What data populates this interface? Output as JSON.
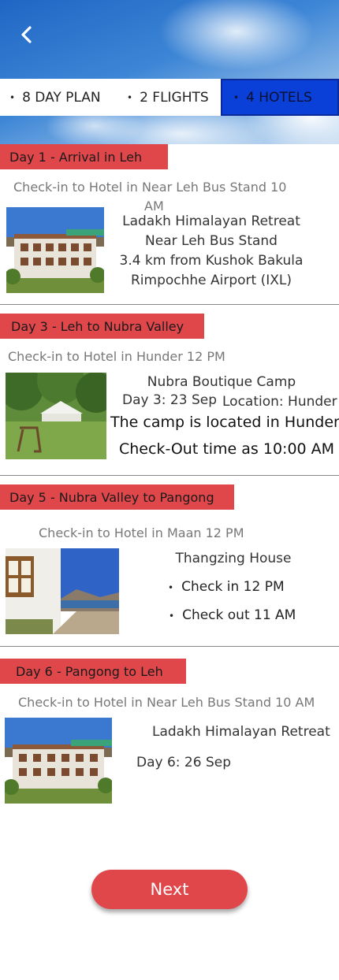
{
  "header": {
    "back_icon": "chevron-left-icon",
    "tabs": [
      {
        "label": "8 DAY PLAN"
      },
      {
        "label": "2 FLIGHTS"
      },
      {
        "label": "4 HOTELS"
      }
    ],
    "bullet": "•"
  },
  "days": [
    {
      "tag": "Day 1 - Arrival in Leh",
      "checkin_line1": "Check-in to Hotel in Near Leh Bus Stand 10",
      "checkin_line2": "AM",
      "lines": [
        "Ladakh Himalayan Retreat",
        "Near Leh Bus Stand",
        "3.4 km from Kushok Bakula",
        "Rimpochhe Airport (IXL)"
      ]
    },
    {
      "tag": "Day 3 - Leh to Nubra Valley",
      "checkin": "Check-in to Hotel in Hunder 12 PM",
      "name": "Nubra Boutique Camp",
      "date": "Day 3: 23 Sep",
      "location": "Location: Hunder",
      "desc1": "The camp is located in Hunder.",
      "desc2": "Check-Out time as 10:00 AM"
    },
    {
      "tag": "Day 5 - Nubra Valley to Pangong",
      "checkin": "Check-in to Hotel in Maan 12 PM",
      "name": "Thangzing House",
      "bullets": [
        "Check in 12 PM",
        "Check out 11 AM"
      ]
    },
    {
      "tag": "Day 6 - Pangong to Leh",
      "checkin": "Check-in to Hotel in Near Leh Bus Stand 10 AM",
      "name": "Ladakh Himalayan Retreat",
      "date": "Day 6: 26 Sep"
    }
  ],
  "next_label": "Next",
  "colors": {
    "accent": "#e0474b",
    "tab_active": "#0a3fd8"
  }
}
